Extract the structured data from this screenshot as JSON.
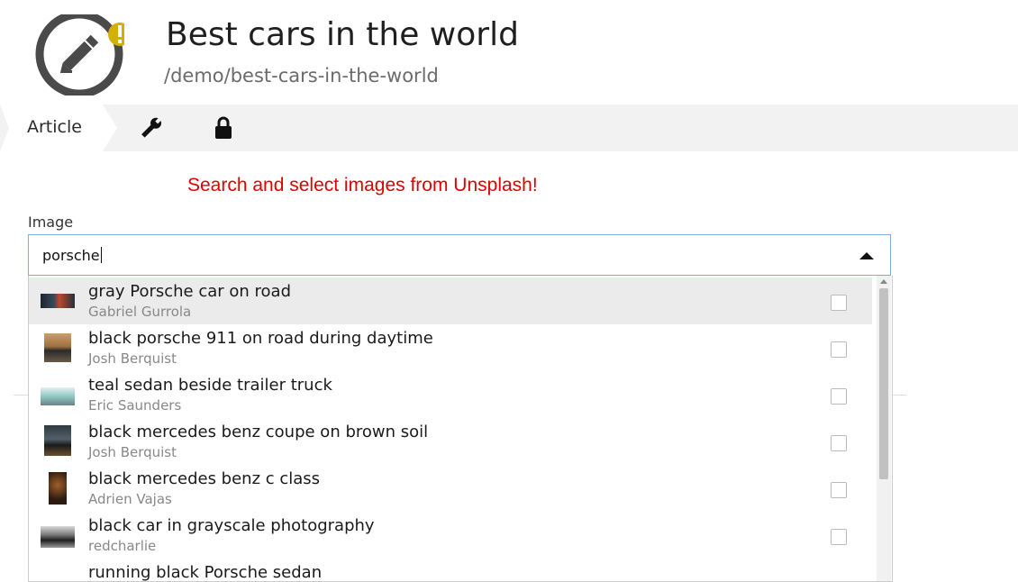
{
  "header": {
    "title": "Best cars in the world",
    "path": "/demo/best-cars-in-the-world"
  },
  "tabs": {
    "article_label": "Article",
    "icons": [
      "wrench-icon",
      "lock-icon"
    ]
  },
  "banner": "Search and select images from Unsplash!",
  "field": {
    "label": "Image",
    "value": "porsche"
  },
  "results": [
    {
      "title": "gray Porsche car on road",
      "author": "Gabriel Gurrola",
      "selected": false
    },
    {
      "title": "black porsche 911 on road during daytime",
      "author": "Josh Berquist",
      "selected": false
    },
    {
      "title": "teal sedan beside trailer truck",
      "author": "Eric Saunders",
      "selected": false
    },
    {
      "title": "black mercedes benz coupe on brown soil",
      "author": "Josh Berquist",
      "selected": false
    },
    {
      "title": "black mercedes benz c class",
      "author": "Adrien Vajas",
      "selected": false
    },
    {
      "title": "black car in grayscale photography",
      "author": "redcharlie",
      "selected": false
    },
    {
      "title": "running black Porsche sedan",
      "author": "",
      "selected": false
    }
  ],
  "colors": {
    "accent_dark": "#4a4a4a",
    "warning_badge": "#d4b000",
    "banner_red": "#e00000",
    "focus_border": "#88aadd"
  }
}
